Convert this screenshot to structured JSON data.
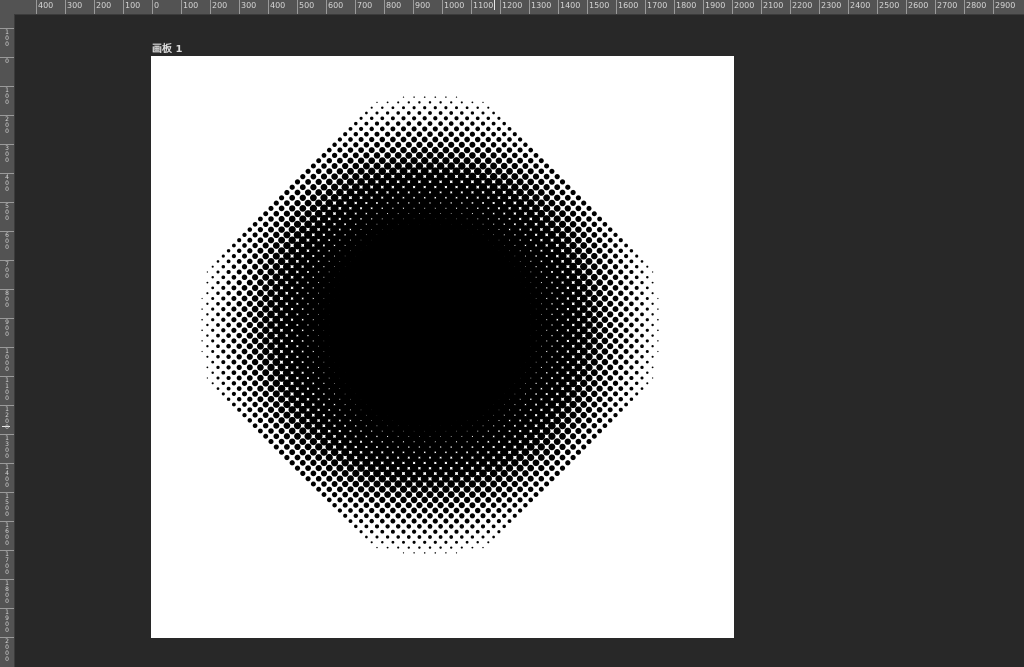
{
  "ruler_top": {
    "labels": [
      "0",
      "400",
      "300",
      "200",
      "100",
      "0",
      "100",
      "200",
      "300",
      "400",
      "500",
      "600",
      "700",
      "800",
      "900",
      "1000",
      "1100",
      "1200",
      "1300",
      "1400",
      "1500",
      "1600",
      "1700",
      "1800",
      "1900",
      "2000",
      "2100",
      "2200",
      "2300",
      "2400",
      "2500",
      "2600",
      "2700",
      "2800",
      "2900"
    ]
  },
  "ruler_left": {
    "labels": [
      "100",
      "0",
      "100",
      "200",
      "300",
      "400",
      "500",
      "600",
      "700",
      "800",
      "900",
      "1000",
      "1100",
      "1200",
      "1300",
      "1400",
      "1500",
      "1600",
      "1700",
      "1800",
      "1900",
      "2000"
    ]
  },
  "artboard": {
    "name": "画板 1",
    "background": "#ffffff"
  },
  "halftone": {
    "dot_color": "#000000",
    "pattern": "radial-halftone-circle"
  },
  "colors": {
    "workspace": "#282828",
    "ruler": "#535353",
    "ruler_text": "#d6d6d6"
  }
}
